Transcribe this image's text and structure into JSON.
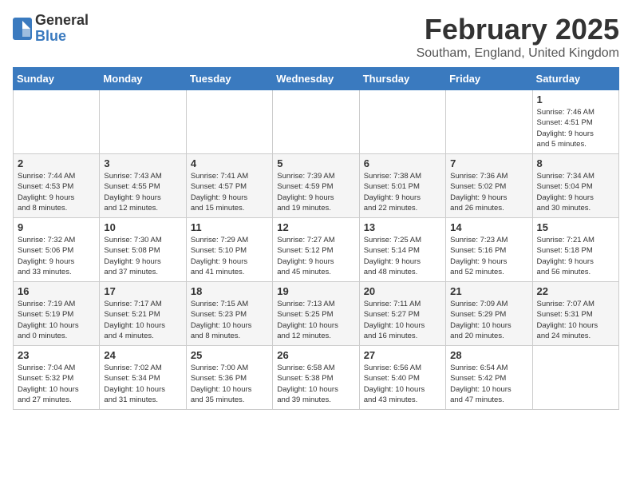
{
  "header": {
    "logo_general": "General",
    "logo_blue": "Blue",
    "title": "February 2025",
    "subtitle": "Southam, England, United Kingdom"
  },
  "weekdays": [
    "Sunday",
    "Monday",
    "Tuesday",
    "Wednesday",
    "Thursday",
    "Friday",
    "Saturday"
  ],
  "weeks": [
    [
      {
        "day": "",
        "info": ""
      },
      {
        "day": "",
        "info": ""
      },
      {
        "day": "",
        "info": ""
      },
      {
        "day": "",
        "info": ""
      },
      {
        "day": "",
        "info": ""
      },
      {
        "day": "",
        "info": ""
      },
      {
        "day": "1",
        "info": "Sunrise: 7:46 AM\nSunset: 4:51 PM\nDaylight: 9 hours\nand 5 minutes."
      }
    ],
    [
      {
        "day": "2",
        "info": "Sunrise: 7:44 AM\nSunset: 4:53 PM\nDaylight: 9 hours\nand 8 minutes."
      },
      {
        "day": "3",
        "info": "Sunrise: 7:43 AM\nSunset: 4:55 PM\nDaylight: 9 hours\nand 12 minutes."
      },
      {
        "day": "4",
        "info": "Sunrise: 7:41 AM\nSunset: 4:57 PM\nDaylight: 9 hours\nand 15 minutes."
      },
      {
        "day": "5",
        "info": "Sunrise: 7:39 AM\nSunset: 4:59 PM\nDaylight: 9 hours\nand 19 minutes."
      },
      {
        "day": "6",
        "info": "Sunrise: 7:38 AM\nSunset: 5:01 PM\nDaylight: 9 hours\nand 22 minutes."
      },
      {
        "day": "7",
        "info": "Sunrise: 7:36 AM\nSunset: 5:02 PM\nDaylight: 9 hours\nand 26 minutes."
      },
      {
        "day": "8",
        "info": "Sunrise: 7:34 AM\nSunset: 5:04 PM\nDaylight: 9 hours\nand 30 minutes."
      }
    ],
    [
      {
        "day": "9",
        "info": "Sunrise: 7:32 AM\nSunset: 5:06 PM\nDaylight: 9 hours\nand 33 minutes."
      },
      {
        "day": "10",
        "info": "Sunrise: 7:30 AM\nSunset: 5:08 PM\nDaylight: 9 hours\nand 37 minutes."
      },
      {
        "day": "11",
        "info": "Sunrise: 7:29 AM\nSunset: 5:10 PM\nDaylight: 9 hours\nand 41 minutes."
      },
      {
        "day": "12",
        "info": "Sunrise: 7:27 AM\nSunset: 5:12 PM\nDaylight: 9 hours\nand 45 minutes."
      },
      {
        "day": "13",
        "info": "Sunrise: 7:25 AM\nSunset: 5:14 PM\nDaylight: 9 hours\nand 48 minutes."
      },
      {
        "day": "14",
        "info": "Sunrise: 7:23 AM\nSunset: 5:16 PM\nDaylight: 9 hours\nand 52 minutes."
      },
      {
        "day": "15",
        "info": "Sunrise: 7:21 AM\nSunset: 5:18 PM\nDaylight: 9 hours\nand 56 minutes."
      }
    ],
    [
      {
        "day": "16",
        "info": "Sunrise: 7:19 AM\nSunset: 5:19 PM\nDaylight: 10 hours\nand 0 minutes."
      },
      {
        "day": "17",
        "info": "Sunrise: 7:17 AM\nSunset: 5:21 PM\nDaylight: 10 hours\nand 4 minutes."
      },
      {
        "day": "18",
        "info": "Sunrise: 7:15 AM\nSunset: 5:23 PM\nDaylight: 10 hours\nand 8 minutes."
      },
      {
        "day": "19",
        "info": "Sunrise: 7:13 AM\nSunset: 5:25 PM\nDaylight: 10 hours\nand 12 minutes."
      },
      {
        "day": "20",
        "info": "Sunrise: 7:11 AM\nSunset: 5:27 PM\nDaylight: 10 hours\nand 16 minutes."
      },
      {
        "day": "21",
        "info": "Sunrise: 7:09 AM\nSunset: 5:29 PM\nDaylight: 10 hours\nand 20 minutes."
      },
      {
        "day": "22",
        "info": "Sunrise: 7:07 AM\nSunset: 5:31 PM\nDaylight: 10 hours\nand 24 minutes."
      }
    ],
    [
      {
        "day": "23",
        "info": "Sunrise: 7:04 AM\nSunset: 5:32 PM\nDaylight: 10 hours\nand 27 minutes."
      },
      {
        "day": "24",
        "info": "Sunrise: 7:02 AM\nSunset: 5:34 PM\nDaylight: 10 hours\nand 31 minutes."
      },
      {
        "day": "25",
        "info": "Sunrise: 7:00 AM\nSunset: 5:36 PM\nDaylight: 10 hours\nand 35 minutes."
      },
      {
        "day": "26",
        "info": "Sunrise: 6:58 AM\nSunset: 5:38 PM\nDaylight: 10 hours\nand 39 minutes."
      },
      {
        "day": "27",
        "info": "Sunrise: 6:56 AM\nSunset: 5:40 PM\nDaylight: 10 hours\nand 43 minutes."
      },
      {
        "day": "28",
        "info": "Sunrise: 6:54 AM\nSunset: 5:42 PM\nDaylight: 10 hours\nand 47 minutes."
      },
      {
        "day": "",
        "info": ""
      }
    ]
  ]
}
